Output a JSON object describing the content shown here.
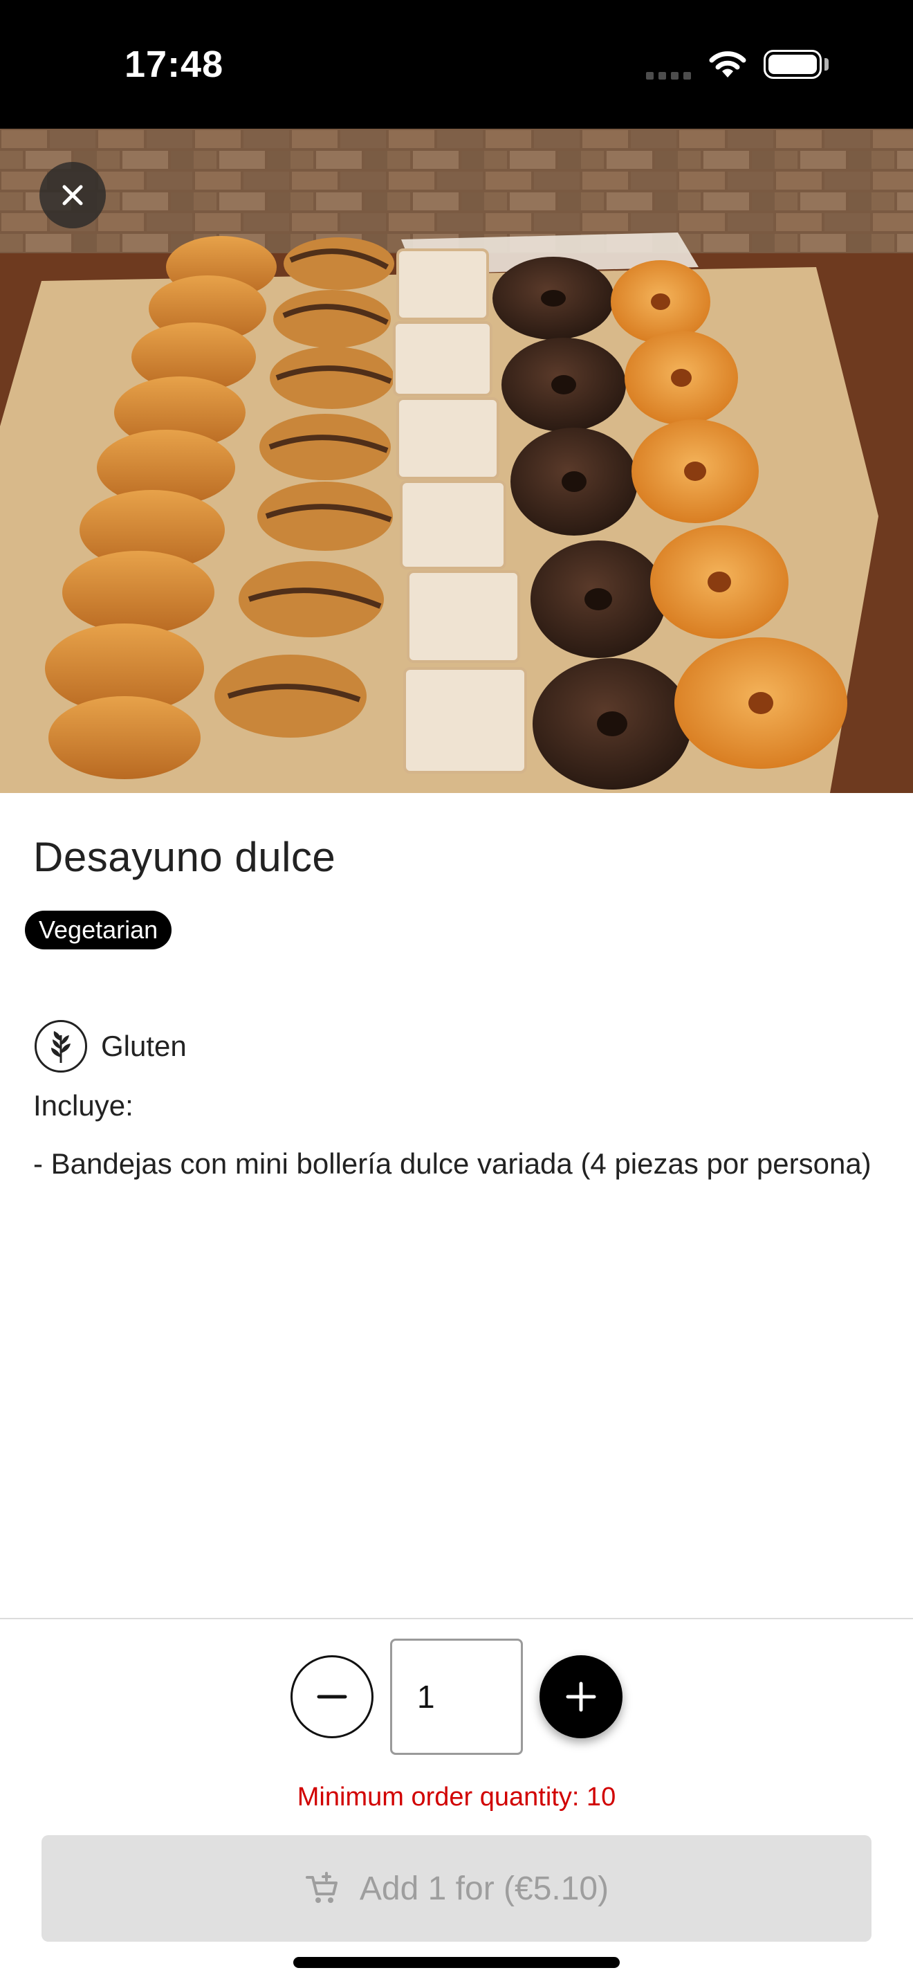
{
  "status_bar": {
    "time": "17:48"
  },
  "product": {
    "title": "Desayuno dulce",
    "tag": "Vegetarian",
    "allergens": [
      {
        "label": "Gluten",
        "icon": "wheat-icon"
      }
    ],
    "description_title": "Incluye:",
    "description_body": "- Bandejas con mini bollería dulce variada (4 piezas por persona)"
  },
  "order": {
    "quantity": "1",
    "min_order_message": "Minimum order quantity: 10",
    "add_button_label": "Add 1 for (€5.10)",
    "add_button_state": "disabled"
  },
  "colors": {
    "accent": "#000000",
    "error": "#d10000",
    "button_disabled_bg": "#e0e0e0",
    "button_disabled_text": "#9e9e9e"
  },
  "icons": [
    "close-icon",
    "wheat-icon",
    "minus-icon",
    "plus-icon",
    "add-to-cart-icon",
    "wifi-icon",
    "battery-icon"
  ]
}
